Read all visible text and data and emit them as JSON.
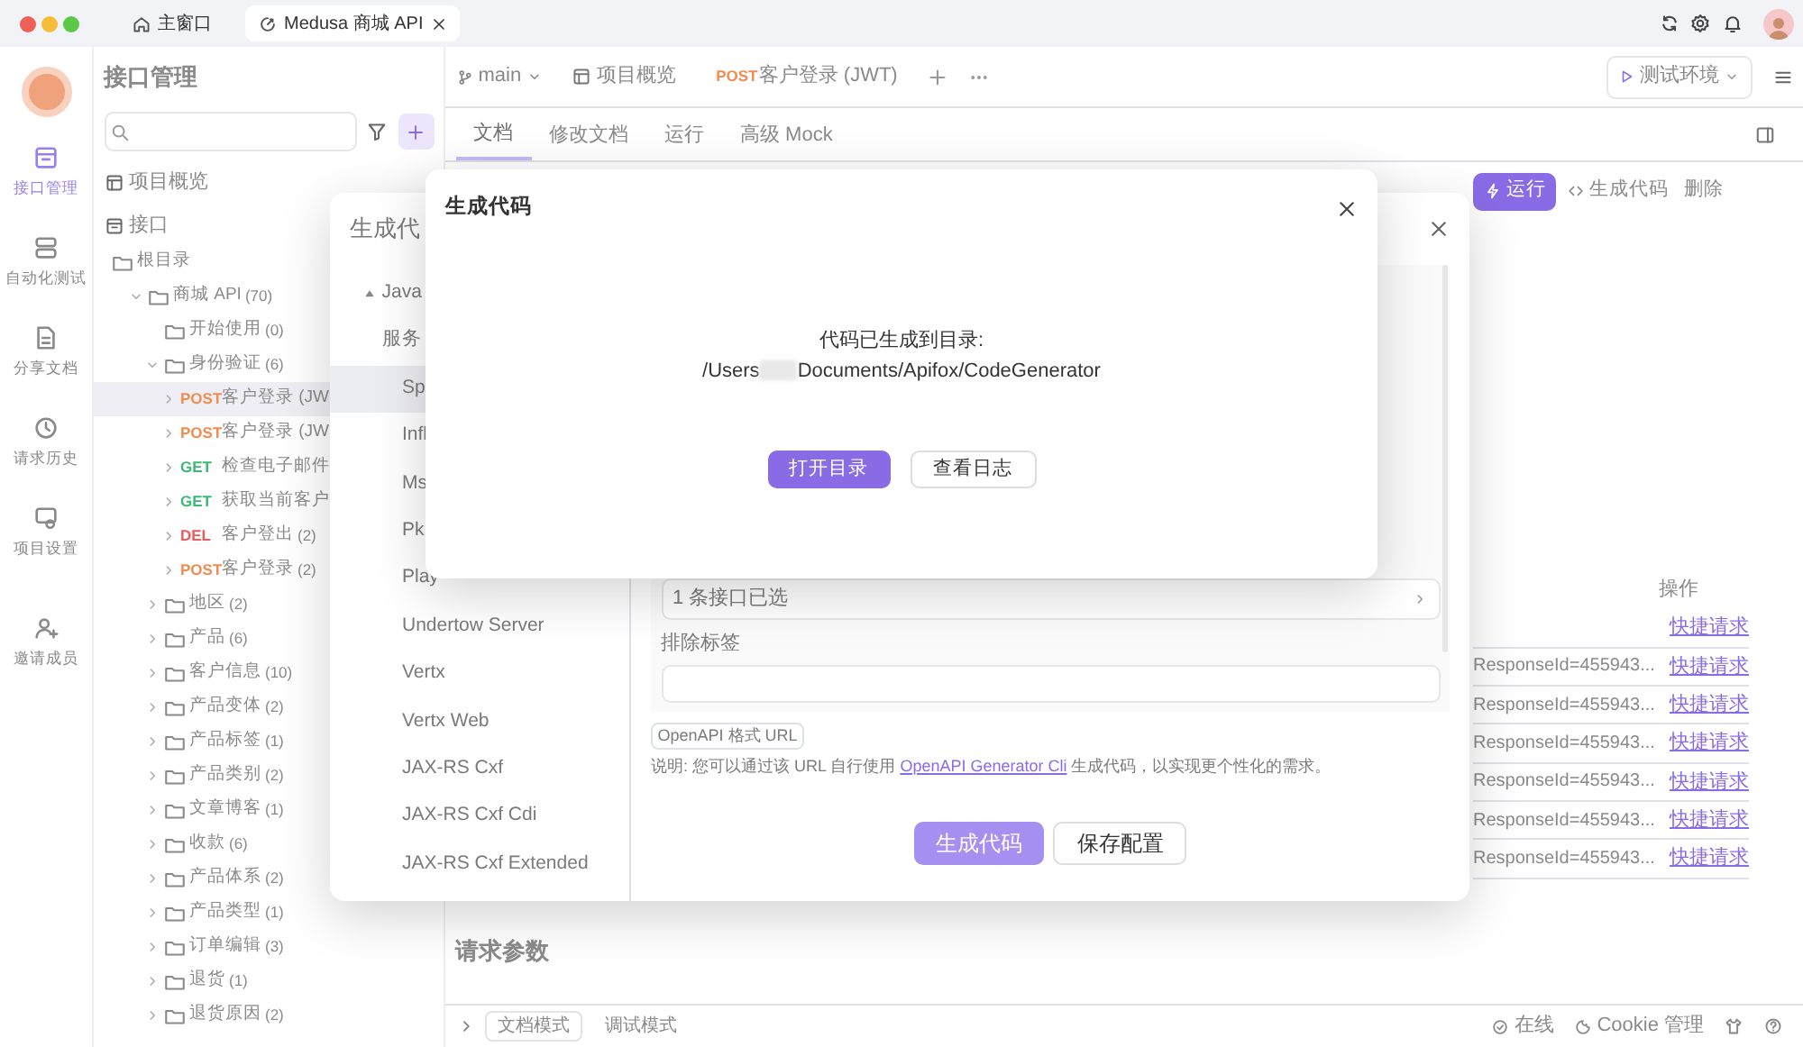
{
  "title_tabs": [
    {
      "label": "主窗口",
      "kind": "home",
      "selected": false
    },
    {
      "label": "Medusa 商城 API",
      "kind": "project",
      "selected": true
    }
  ],
  "rail": {
    "items": [
      {
        "label": "接口管理",
        "kind": "api",
        "selected": true
      },
      {
        "label": "自动化测试",
        "kind": "test",
        "selected": false
      },
      {
        "label": "分享文档",
        "kind": "docs",
        "selected": false
      },
      {
        "label": "请求历史",
        "kind": "history",
        "selected": false
      },
      {
        "label": "项目设置",
        "kind": "settings",
        "selected": false
      }
    ],
    "footer_items": [
      {
        "label": "邀请成员",
        "kind": "invite",
        "selected": false
      }
    ]
  },
  "sidebar": {
    "title": "接口管理",
    "nav": [
      {
        "label": "项目概览",
        "kind": "overview"
      },
      {
        "label": "接口",
        "kind": "api"
      }
    ],
    "tree": [
      {
        "label": "根目录",
        "kind": "folder",
        "selected": false,
        "children": [
          {
            "label": "商城 API",
            "count": "(70)",
            "kind": "folder",
            "expanded": true,
            "selected": false,
            "children": [
              {
                "label": "开始使用",
                "count": "(0)",
                "kind": "folder",
                "selected": false
              },
              {
                "label": "身份验证",
                "count": "(6)",
                "kind": "folder",
                "expanded": true,
                "selected": false,
                "children": [
                  {
                    "method": "POST",
                    "color": "#f08d52",
                    "label": "客户登录 (JW",
                    "kind": "endpoint",
                    "expanded": false,
                    "selected": true
                  },
                  {
                    "method": "POST",
                    "color": "#f08d52",
                    "label": "客户登录 (JW",
                    "kind": "endpoint",
                    "expanded": false,
                    "selected": false
                  },
                  {
                    "method": "GET",
                    "color": "#3cb878",
                    "label": "检查电子邮件",
                    "kind": "endpoint",
                    "expanded": false,
                    "selected": false
                  },
                  {
                    "method": "GET",
                    "color": "#3cb878",
                    "label": "获取当前客户",
                    "kind": "endpoint",
                    "expanded": false,
                    "selected": false
                  },
                  {
                    "method": "DEL",
                    "color": "#ef5a5a",
                    "label": "客户登出",
                    "count": "(2)",
                    "kind": "endpoint",
                    "expanded": false,
                    "selected": false
                  },
                  {
                    "method": "POST",
                    "color": "#f08d52",
                    "label": "客户登录",
                    "count": "(2)",
                    "kind": "endpoint",
                    "expanded": false,
                    "selected": false
                  }
                ]
              },
              {
                "label": "地区",
                "count": "(2)",
                "kind": "folder",
                "expanded": false,
                "selected": false
              },
              {
                "label": "产品",
                "count": "(6)",
                "kind": "folder",
                "expanded": false,
                "selected": false
              },
              {
                "label": "客户信息",
                "count": "(10)",
                "kind": "folder",
                "expanded": false,
                "selected": false
              },
              {
                "label": "产品变体",
                "count": "(2)",
                "kind": "folder",
                "expanded": false,
                "selected": false
              },
              {
                "label": "产品标签",
                "count": "(1)",
                "kind": "folder",
                "expanded": false,
                "selected": false
              },
              {
                "label": "产品类别",
                "count": "(2)",
                "kind": "folder",
                "expanded": false,
                "selected": false
              },
              {
                "label": "文章博客",
                "count": "(1)",
                "kind": "folder",
                "expanded": false,
                "selected": false
              },
              {
                "label": "收款",
                "count": "(6)",
                "kind": "folder",
                "expanded": false,
                "selected": false
              },
              {
                "label": "产品体系",
                "count": "(2)",
                "kind": "folder",
                "expanded": false,
                "selected": false
              },
              {
                "label": "产品类型",
                "count": "(1)",
                "kind": "folder",
                "expanded": false,
                "selected": false
              },
              {
                "label": "订单编辑",
                "count": "(3)",
                "kind": "folder",
                "expanded": false,
                "selected": false
              },
              {
                "label": "退货",
                "count": "(1)",
                "kind": "folder",
                "expanded": false,
                "selected": false
              },
              {
                "label": "退货原因",
                "count": "(2)",
                "kind": "folder",
                "expanded": false,
                "selected": false
              }
            ]
          }
        ]
      }
    ]
  },
  "header": {
    "branch": "main",
    "tabs": [
      {
        "label": "项目概览"
      },
      {
        "method": "POST",
        "color": "#f08d52",
        "label": "客户登录 (JWT)"
      }
    ],
    "environment": "测试环境"
  },
  "content": {
    "tabs": [
      {
        "label": "文档",
        "selected": true
      },
      {
        "label": "修改文档",
        "selected": false
      },
      {
        "label": "运行",
        "selected": false
      },
      {
        "label": "高级 Mock",
        "selected": false
      }
    ],
    "actions": [
      {
        "label": "运行",
        "kind": "primary"
      },
      {
        "label": "生成代码",
        "kind": "code"
      },
      {
        "label": "删除",
        "kind": "plain"
      }
    ],
    "table": {
      "columns": [
        "操作"
      ],
      "rows": [
        {
          "action": "快捷请求"
        },
        {
          "response": "ResponseId=455943...",
          "action": "快捷请求"
        },
        {
          "response": "ResponseId=455943...",
          "action": "快捷请求"
        },
        {
          "response": "ResponseId=455943...",
          "action": "快捷请求"
        },
        {
          "response": "ResponseId=455943...",
          "action": "快捷请求"
        },
        {
          "response": "ResponseId=455943...",
          "action": "快捷请求"
        },
        {
          "response": "ResponseId=455943...",
          "action": "快捷请求"
        }
      ]
    },
    "section_title": "请求参数"
  },
  "footer": {
    "modes": [
      {
        "label": "文档模式",
        "selected": true
      },
      {
        "label": "调试模式",
        "selected": false
      }
    ],
    "status": [
      {
        "label": "在线",
        "kind": "online"
      },
      {
        "label": "Cookie 管理",
        "kind": "cookie"
      }
    ]
  },
  "generate_dialog": {
    "title": "生成代",
    "languages": [
      {
        "label": "Java",
        "expanded": true,
        "children": [
          {
            "label": "服务",
            "children": [
              {
                "label": "Sp",
                "selected": true
              },
              {
                "label": "Infl",
                "selected": false
              },
              {
                "label": "Ms",
                "selected": false
              },
              {
                "label": "Pk",
                "selected": false
              },
              {
                "label": "Play",
                "selected": false
              },
              {
                "label": "Undertow Server",
                "selected": false
              },
              {
                "label": "Vertx",
                "selected": false
              },
              {
                "label": "Vertx Web",
                "selected": false
              },
              {
                "label": "JAX-RS Cxf",
                "selected": false
              },
              {
                "label": "JAX-RS Cxf Cdi",
                "selected": false
              },
              {
                "label": "JAX-RS Cxf Extended",
                "selected": false
              }
            ]
          }
        ]
      }
    ],
    "selected_apis": "1 条接口已选",
    "exclude_label": "排除标签",
    "url_tag": "OpenAPI 格式 URL",
    "note_before": "说明: 您可以通过该 URL 自行使用 ",
    "note_link": "OpenAPI Generator Cli",
    "note_after": " 生成代码，以实现更个性化的需求。",
    "buttons": [
      {
        "label": "生成代码",
        "kind": "primary"
      },
      {
        "label": "保存配置",
        "kind": "secondary"
      }
    ]
  },
  "result_dialog": {
    "title": "生成代码",
    "message": "代码已生成到目录:",
    "path_prefix": "/Users",
    "path_suffix": "Documents/Apifox/CodeGenerator",
    "buttons": [
      {
        "label": "打开目录",
        "kind": "primary"
      },
      {
        "label": "查看日志",
        "kind": "secondary"
      }
    ]
  }
}
